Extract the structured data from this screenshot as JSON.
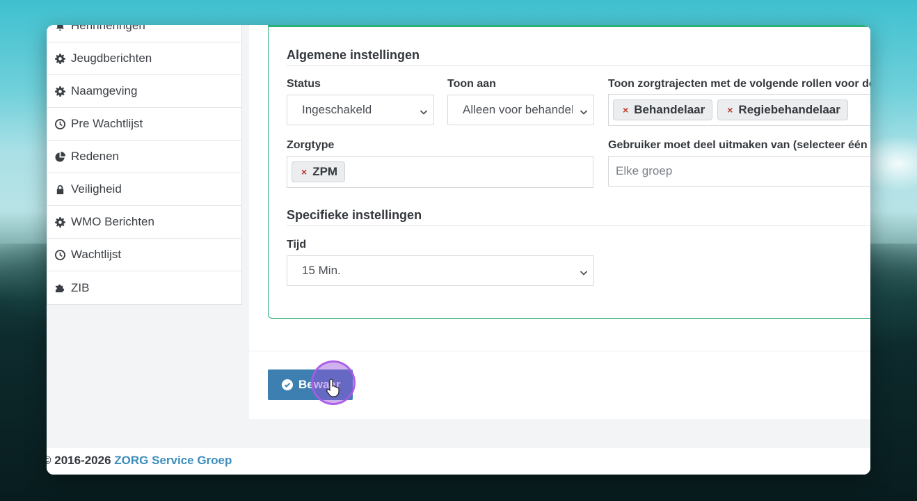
{
  "sidebar": {
    "items": [
      {
        "label": "Herinneringen",
        "icon": "bell-icon"
      },
      {
        "label": "Jeugdberichten",
        "icon": "gear-icon"
      },
      {
        "label": "Naamgeving",
        "icon": "gear-icon"
      },
      {
        "label": "Pre Wachtlijst",
        "icon": "clock-icon"
      },
      {
        "label": "Redenen",
        "icon": "pie-chart-icon"
      },
      {
        "label": "Veiligheid",
        "icon": "lock-icon"
      },
      {
        "label": "WMO Berichten",
        "icon": "gear-icon"
      },
      {
        "label": "Wachtlijst",
        "icon": "clock-icon"
      },
      {
        "label": "ZIB",
        "icon": "puzzle-icon"
      }
    ]
  },
  "general": {
    "title": "Algemene instellingen",
    "status_label": "Status",
    "status_value": "Ingeschakeld",
    "show_label": "Toon aan",
    "show_value": "Alleen voor behandelaar",
    "roles_label": "Toon zorgtrajecten met de volgende rollen voor de gebruiker",
    "roles": [
      "Behandelaar",
      "Regiebehandelaar"
    ],
    "caretype_label": "Zorgtype",
    "caretypes": [
      "ZPM"
    ],
    "group_label": "Gebruiker moet deel uitmaken van (selecteer één of meer groepen)",
    "group_placeholder": "Elke groep"
  },
  "specific": {
    "title": "Specifieke instellingen",
    "time_label": "Tijd",
    "time_value": "15 Min."
  },
  "actions": {
    "save_label": "Bewaar"
  },
  "footer": {
    "copyright": "© 2016-2026 ",
    "company": "ZORG Service Groep"
  },
  "colors": {
    "accent_green": "#2bb07a",
    "button_blue": "#3c7fb0",
    "link_blue": "#3c8dbc",
    "remove_red": "#c0392b"
  }
}
